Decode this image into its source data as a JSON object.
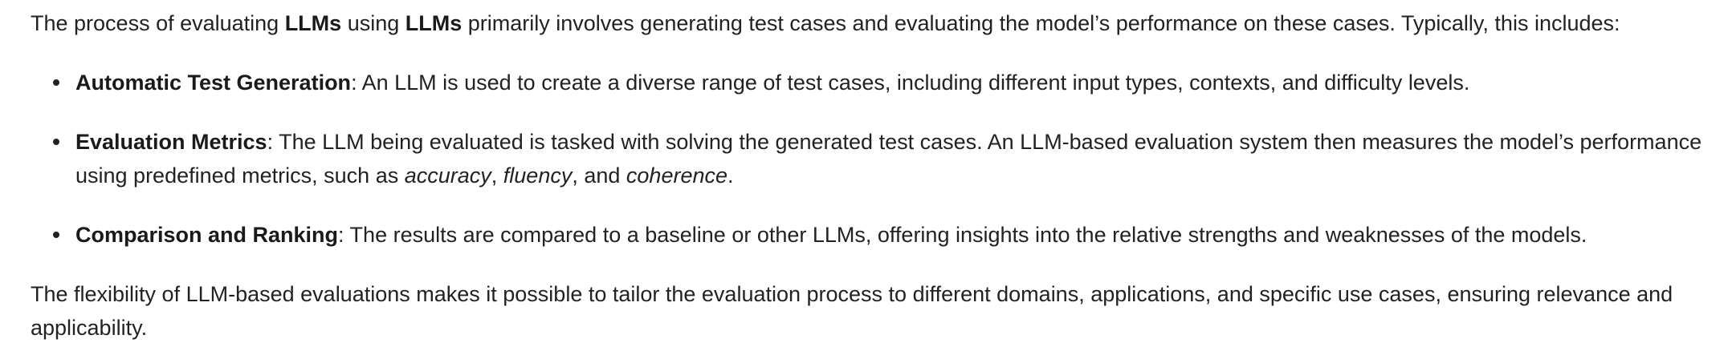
{
  "intro": {
    "t1": "The process of evaluating ",
    "b1": "LLMs",
    "t2": " using ",
    "b2": "LLMs",
    "t3": " primarily involves generating test cases and evaluating the model’s performance on these cases. Typically, this includes:"
  },
  "items": [
    {
      "title": "Automatic Test Generation",
      "text": ": An LLM is used to create a diverse range of test cases, including different input types, contexts, and difficulty levels."
    },
    {
      "title": "Evaluation Metrics",
      "text": ": The LLM being evaluated is tasked with solving the generated test cases. An LLM-based evaluation system then measures the model’s performance using predefined metrics, such as ",
      "m1": "accuracy",
      "sep1": ", ",
      "m2": "fluency",
      "sep2": ", and ",
      "m3": "coherence",
      "end": "."
    },
    {
      "title": "Comparison and Ranking",
      "text": ": The results are compared to a baseline or other LLMs, offering insights into the relative strengths and weaknesses of the models."
    }
  ],
  "closing": "The flexibility of LLM-based evaluations makes it possible to tailor the evaluation process to different domains, applications, and specific use cases, ensuring relevance and applicability."
}
